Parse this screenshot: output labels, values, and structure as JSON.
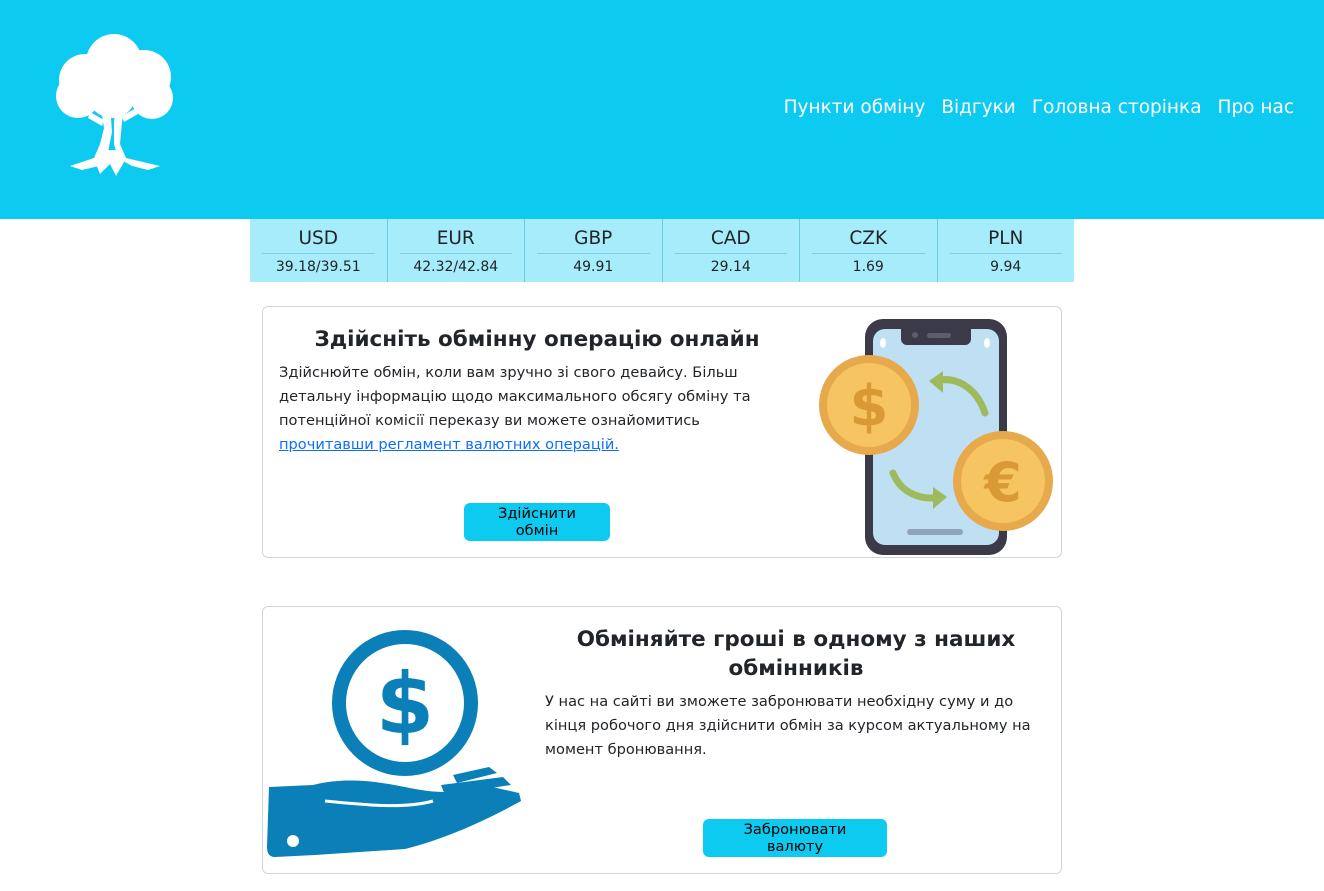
{
  "nav": {
    "items": [
      "Пункти обміну",
      "Відгуки",
      "Головна сторінка",
      "Про нас"
    ]
  },
  "rates": [
    {
      "currency": "USD",
      "value": "39.18/39.51"
    },
    {
      "currency": "EUR",
      "value": "42.32/42.84"
    },
    {
      "currency": "GBP",
      "value": "49.91"
    },
    {
      "currency": "CAD",
      "value": "29.14"
    },
    {
      "currency": "CZK",
      "value": "1.69"
    },
    {
      "currency": "PLN",
      "value": "9.94"
    }
  ],
  "online": {
    "title": "Здійсніть обмінну операцію онлайн",
    "text": "Здійснюйте обмін, коли вам зручно зі свого девайсу. Більш детальну інформацію щодо максимального обсягу обміну та потенційної комісії переказу ви можете ознайомитись",
    "link": "прочитавши регламент валютних операцій.",
    "button": "Здійснити обмін"
  },
  "offline": {
    "title": "Обміняйте гроші в одному з наших обмінників",
    "text": "У нас на сайті ви зможете забронювати необхідну суму и до кінця робочого дня здійснити обмін за курсом актуальному на момент бронювання.",
    "button": "Забронювати валюту"
  },
  "colors": {
    "header": "#0dcaf0",
    "rates_bg": "#a6ecfa",
    "button": "#0dcaf0",
    "link": "#0d6efd",
    "hand_icon": "#0a7fb8"
  },
  "icons": {
    "logo": "tree-logo-icon",
    "phone": "phone-exchange-icon",
    "hand": "hand-dollar-icon"
  }
}
